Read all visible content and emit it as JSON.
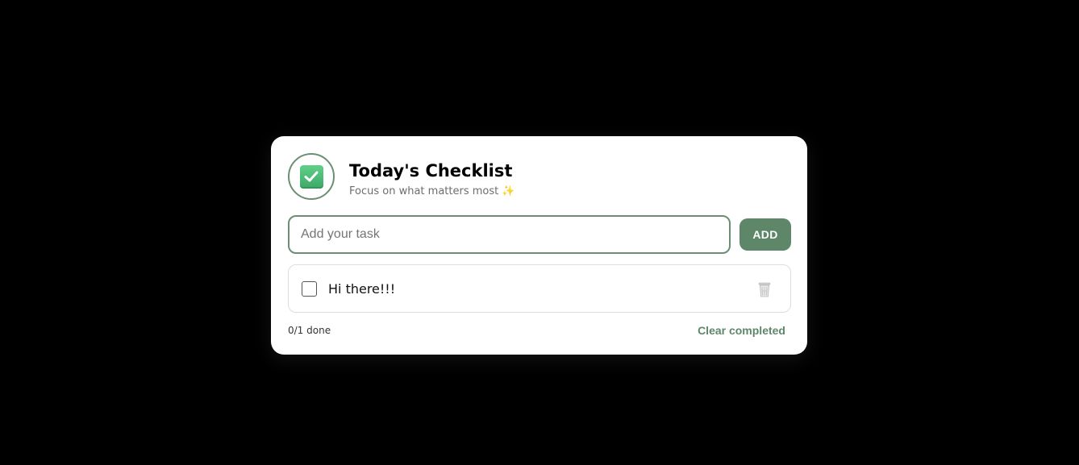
{
  "app": {
    "title": "Today's Checklist",
    "subtitle": "Focus on what matters most",
    "subtitle_emoji": "✨",
    "logo_icon": "check-box-icon"
  },
  "input": {
    "value": "",
    "placeholder": "Add your task"
  },
  "add_button": {
    "label": "ADD"
  },
  "tasks": [
    {
      "text": "Hi there!!!",
      "completed": false
    }
  ],
  "footer": {
    "done_count": "0/1 done",
    "clear_label": "Clear completed"
  },
  "colors": {
    "accent": "#5e876a",
    "background": "#000000",
    "card": "#ffffff"
  }
}
